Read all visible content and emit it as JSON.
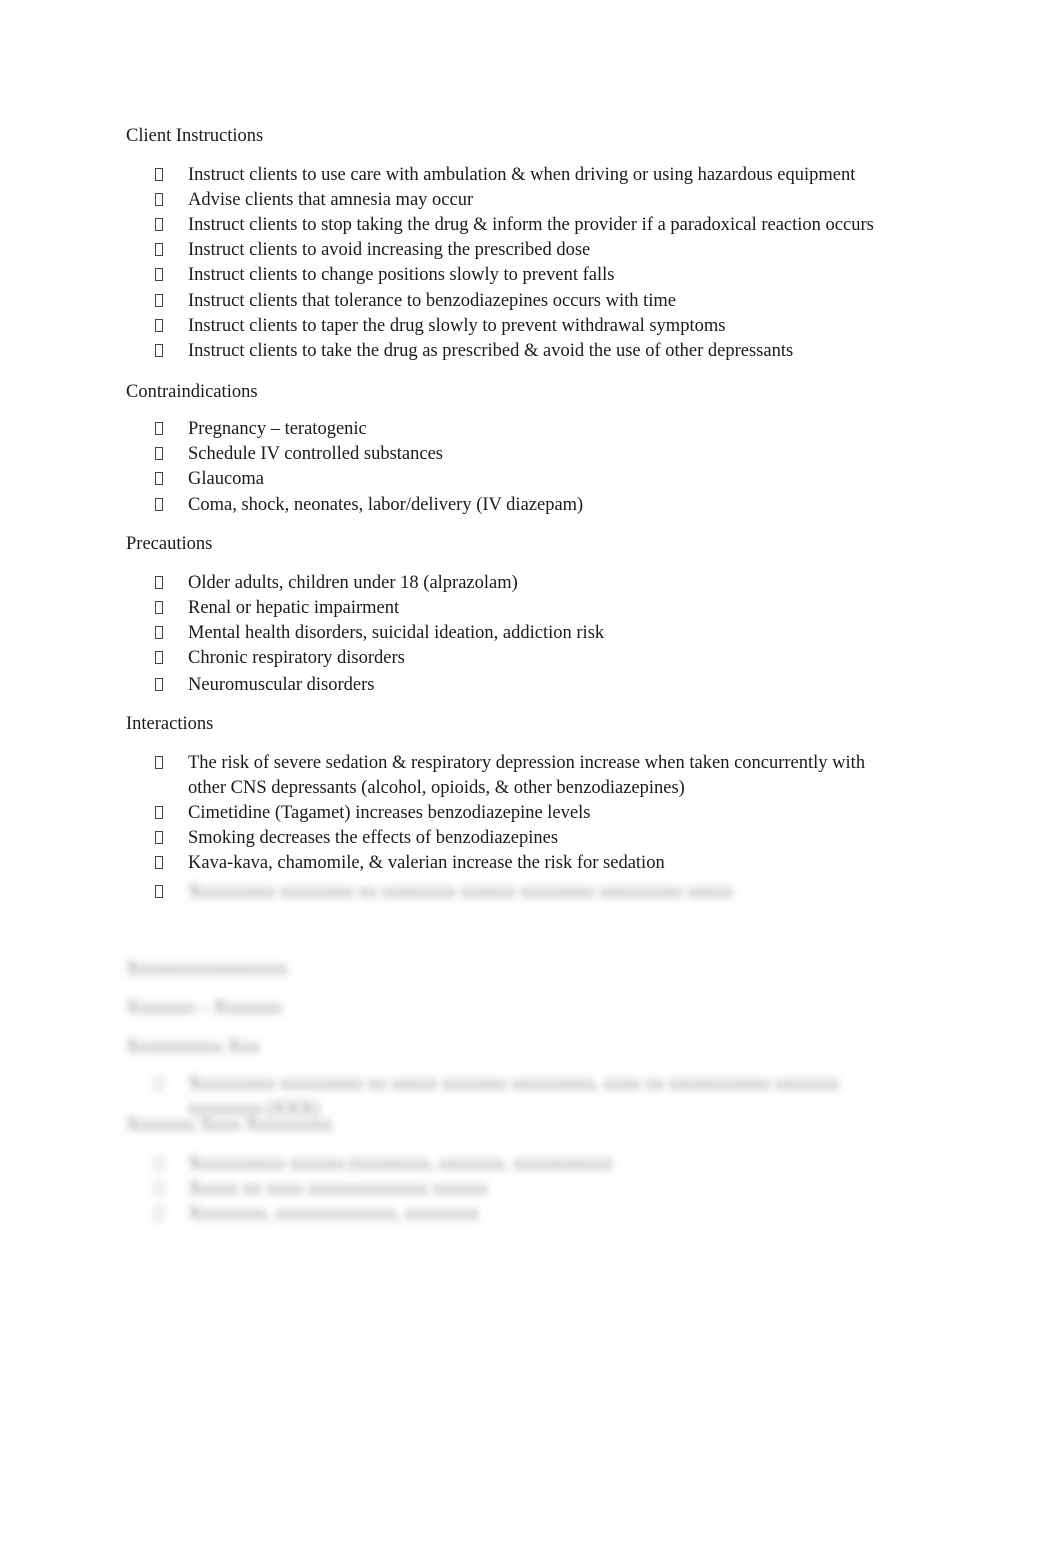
{
  "sections": [
    {
      "heading": "Client Instructions",
      "items": [
        "Instruct clients to use care with ambulation & when driving or using hazardous equipment",
        "Advise clients that amnesia may occur",
        "Instruct clients to stop taking the drug & inform the provider if a paradoxical reaction occurs",
        "Instruct clients to avoid increasing the prescribed dose",
        "Instruct clients to change positions slowly to prevent falls",
        "Instruct clients that tolerance to benzodiazepines occurs with time",
        "Instruct clients to taper the drug slowly to prevent withdrawal symptoms",
        "Instruct clients to take the drug as prescribed & avoid the use of other depressants"
      ]
    },
    {
      "heading": "Contraindications",
      "items": [
        "Pregnancy – teratogenic",
        "Schedule IV controlled substances",
        "Glaucoma",
        "Coma, shock, neonates, labor/delivery (IV diazepam)"
      ]
    },
    {
      "heading": "Precautions",
      "items": [
        "Older adults, children under 18 (alprazolam)",
        "Renal or hepatic impairment",
        "Mental health disorders, suicidal ideation, addiction risk",
        "Chronic respiratory disorders",
        "Neuromuscular disorders"
      ]
    },
    {
      "heading": "Interactions",
      "items": [
        "The risk of severe sedation & respiratory depression increase when taken concurrently with other CNS depressants (alcohol, opioids, & other benzodiazepines)",
        "Cimetidine (Tagamet) increases benzodiazepine levels",
        "Smoking decreases the effects of benzodiazepines",
        "Kava-kava, chamomile, & valerian increase the risk for sedation"
      ]
    }
  ],
  "blurred": {
    "interaction_last": "Xxxxxxxxx xxxxxxxx xx xxxxxxxx xxxxxx xxxxxxxx xxxxxxxxx xxxxx",
    "heading_1": "Xxxxxxxxxxxxxxxxx",
    "heading_2": "Xxxxxxx – Xxxxxxx",
    "heading_3": "Xxxxxxxxxx Xxx",
    "use_item": "Xxxxxxxxx xxxxxxxxx xx xxxxx xxxxxxx xxxxxxxxx, xxxx xx xxxxxxxxxxx xxxxxxx xxxxxxxx (XXX)",
    "heading_4": "Xxxxxxx Xxxx Xxxxxxxxx",
    "adverse_items": [
      "Xxxxxxxxxx xxxxxx (xxxxxxxx, xxxxxxx, xxxxxxxxxx)",
      "Xxxxx xx xxxx xxxxxxxxxxxxx xxxxxx",
      "Xxxxxxxx, xxxxxxxxxxxxx, xxxxxxxx"
    ]
  }
}
